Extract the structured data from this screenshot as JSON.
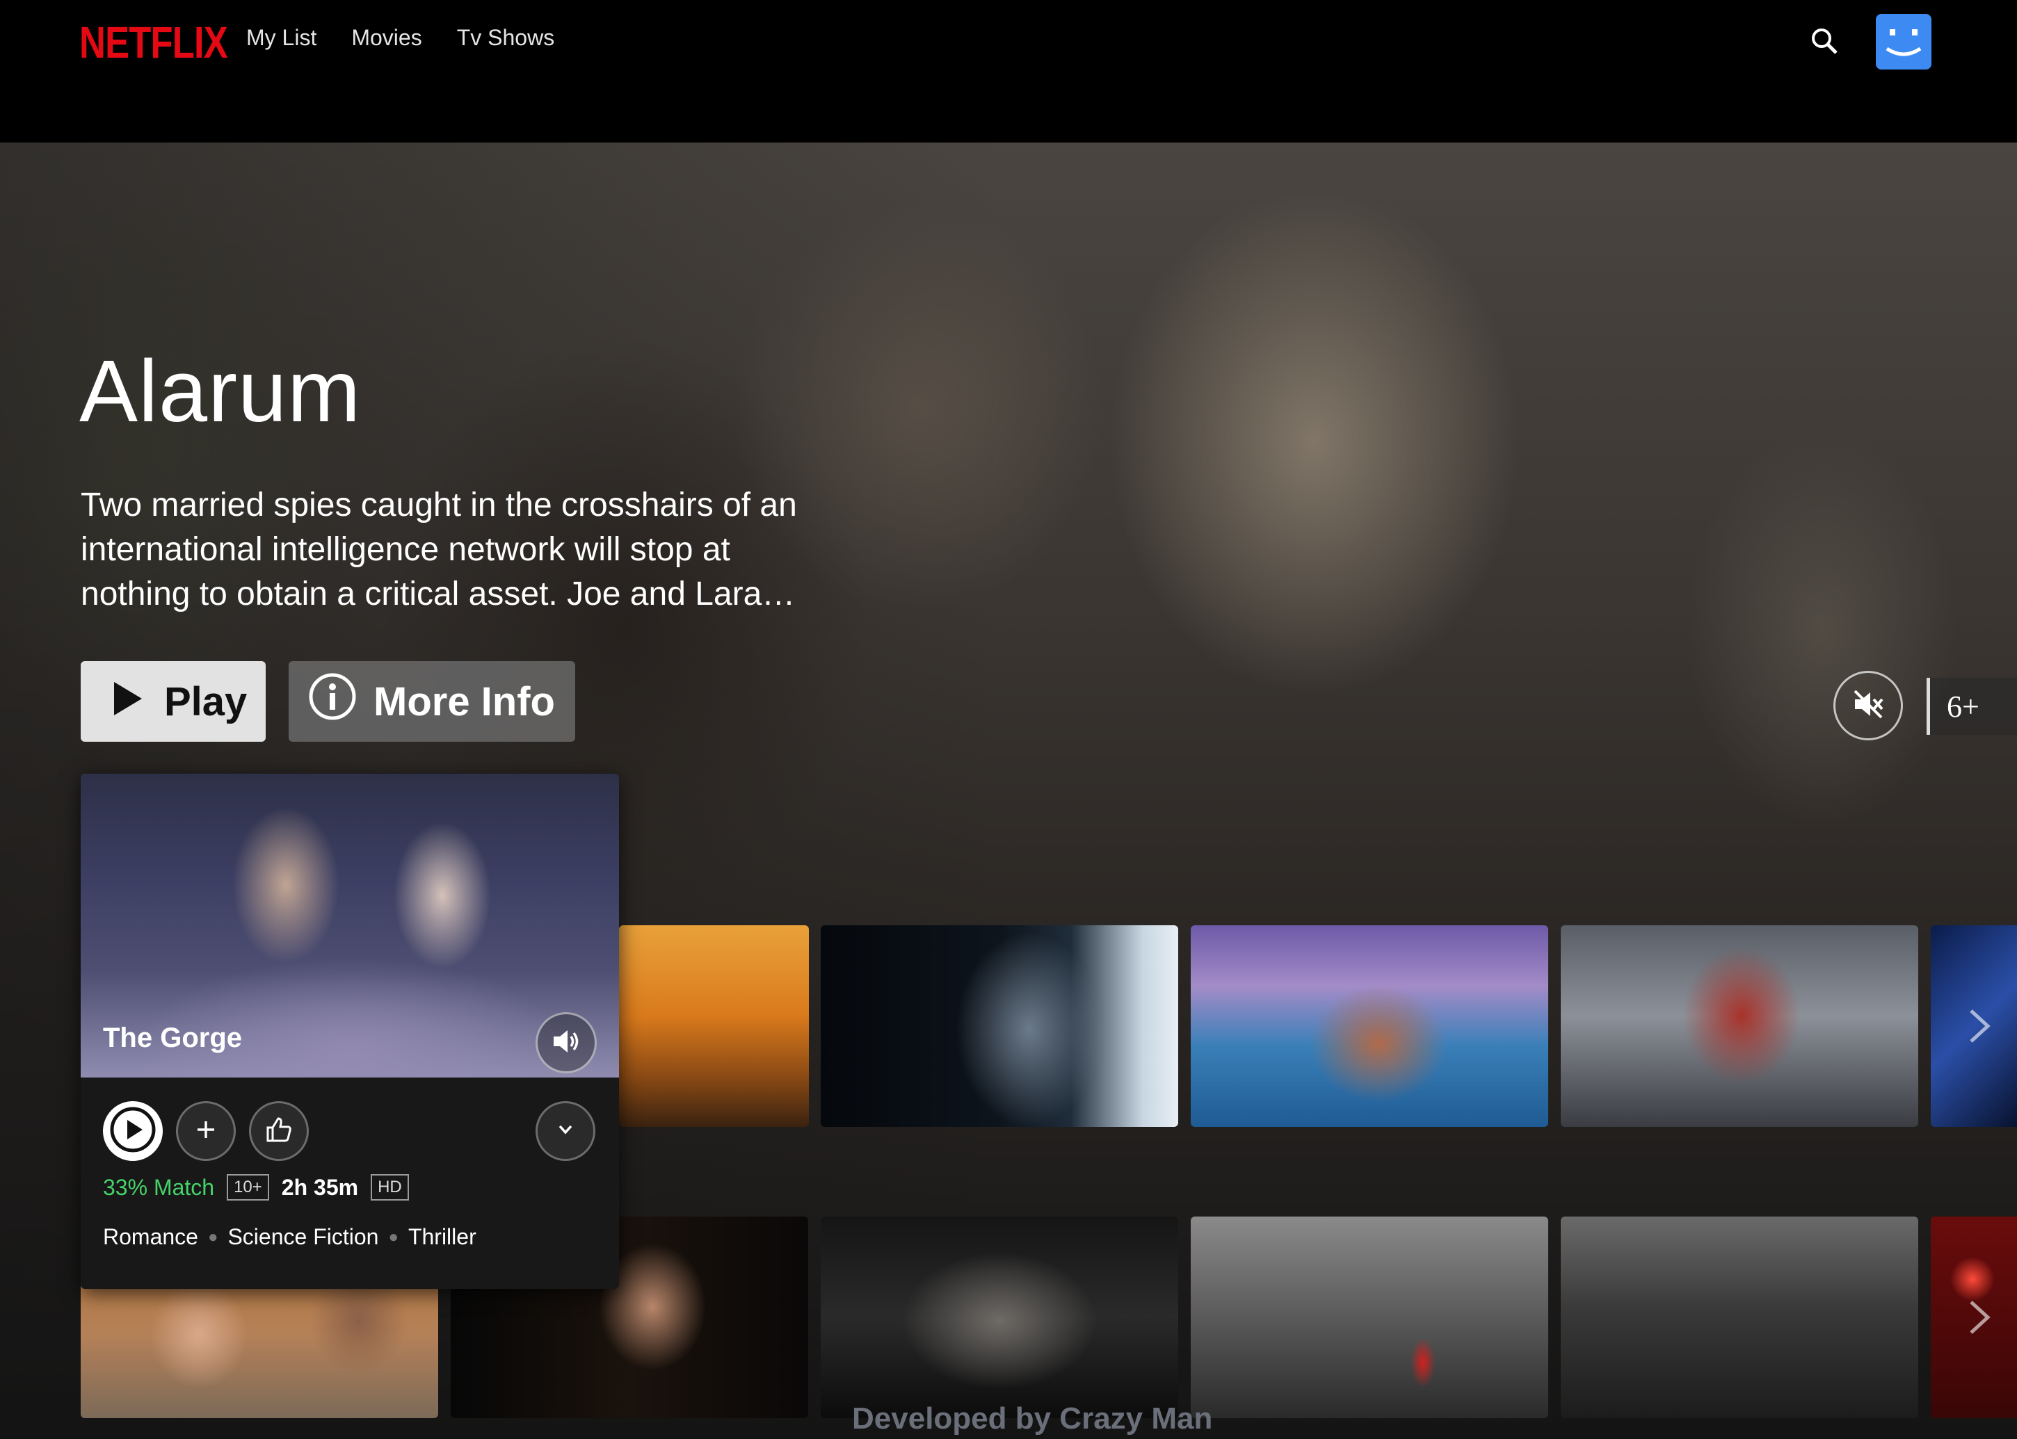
{
  "header": {
    "logo": "NETFLIX",
    "nav": [
      "My List",
      "Movies",
      "Tv Shows"
    ]
  },
  "hero": {
    "title": "Alarum",
    "description": "Two married spies caught in the crosshairs of an international intelligence network will stop at nothing to obtain a critical asset. Joe and Lara…",
    "play_label": "Play",
    "info_label": "More Info",
    "maturity": "6+"
  },
  "preview_card": {
    "title": "The Gorge",
    "match": "33% Match",
    "rating": "10+",
    "duration": "2h 35m",
    "quality": "HD",
    "genres": [
      "Romance",
      "Science Fiction",
      "Thriller"
    ]
  },
  "footer_text": "Developed by Crazy Man",
  "colors": {
    "brand": "#e50914",
    "match": "#46d369",
    "background": "#141414",
    "avatar": "#3d8bf2"
  }
}
